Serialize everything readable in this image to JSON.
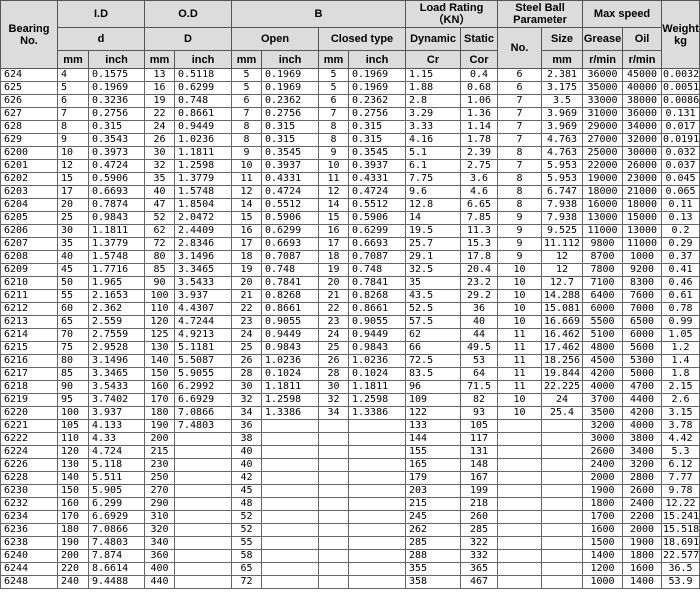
{
  "headers": {
    "bearing_no": "Bearing No.",
    "id": "I.D",
    "od": "O.D",
    "b": "B",
    "load_rating": "Load Rating （KN）",
    "steel_ball": "Steel Ball Parameter",
    "max_speed": "Max speed",
    "weight": "Weight kg",
    "d": "d",
    "D": "D",
    "open": "Open",
    "closed_type": "Closed type",
    "dynamic": "Dynamic",
    "static": "Static",
    "no": "No.",
    "size": "Size",
    "grease": "Grease",
    "oil": "Oil",
    "mm": "mm",
    "inch": "inch",
    "cr": "Cr",
    "cor": "Cor",
    "rmin": "r/min"
  },
  "rows": [
    [
      "624",
      "4",
      "0.1575",
      "13",
      "0.5118",
      "5",
      "0.1969",
      "5",
      "0.1969",
      "1.15",
      "0.4",
      "6",
      "2.381",
      "36000",
      "45000",
      "0.0032"
    ],
    [
      "625",
      "5",
      "0.1969",
      "16",
      "0.6299",
      "5",
      "0.1969",
      "5",
      "0.1969",
      "1.88",
      "0.68",
      "6",
      "3.175",
      "35000",
      "40000",
      "0.0051"
    ],
    [
      "626",
      "6",
      "0.3236",
      "19",
      "0.748",
      "6",
      "0.2362",
      "6",
      "0.2362",
      "2.8",
      "1.06",
      "7",
      "3.5",
      "33000",
      "38000",
      "0.0086"
    ],
    [
      "627",
      "7",
      "0.2756",
      "22",
      "0.8661",
      "7",
      "0.2756",
      "7",
      "0.2756",
      "3.29",
      "1.36",
      "7",
      "3.969",
      "31000",
      "36000",
      "0.131"
    ],
    [
      "628",
      "8",
      "0.315",
      "24",
      "0.9449",
      "8",
      "0.315",
      "8",
      "0.315",
      "3.33",
      "1.14",
      "7",
      "3.969",
      "29000",
      "34000",
      "0.017"
    ],
    [
      "629",
      "9",
      "0.3543",
      "26",
      "1.0236",
      "8",
      "0.315",
      "8",
      "0.315",
      "4.16",
      "1.78",
      "7",
      "4.763",
      "27000",
      "32000",
      "0.0191"
    ],
    [
      "6200",
      "10",
      "0.3973",
      "30",
      "1.1811",
      "9",
      "0.3545",
      "9",
      "0.3545",
      "5.1",
      "2.39",
      "8",
      "4.763",
      "25000",
      "30000",
      "0.032"
    ],
    [
      "6201",
      "12",
      "0.4724",
      "32",
      "1.2598",
      "10",
      "0.3937",
      "10",
      "0.3937",
      "6.1",
      "2.75",
      "7",
      "5.953",
      "22000",
      "26000",
      "0.037"
    ],
    [
      "6202",
      "15",
      "0.5906",
      "35",
      "1.3779",
      "11",
      "0.4331",
      "11",
      "0.4331",
      "7.75",
      "3.6",
      "8",
      "5.953",
      "19000",
      "23000",
      "0.045"
    ],
    [
      "6203",
      "17",
      "0.6693",
      "40",
      "1.5748",
      "12",
      "0.4724",
      "12",
      "0.4724",
      "9.6",
      "4.6",
      "8",
      "6.747",
      "18000",
      "21000",
      "0.065"
    ],
    [
      "6204",
      "20",
      "0.7874",
      "47",
      "1.8504",
      "14",
      "0.5512",
      "14",
      "0.5512",
      "12.8",
      "6.65",
      "8",
      "7.938",
      "16000",
      "18000",
      "0.11"
    ],
    [
      "6205",
      "25",
      "0.9843",
      "52",
      "2.0472",
      "15",
      "0.5906",
      "15",
      "0.5906",
      "14",
      "7.85",
      "9",
      "7.938",
      "13000",
      "15000",
      "0.13"
    ],
    [
      "6206",
      "30",
      "1.1811",
      "62",
      "2.4409",
      "16",
      "0.6299",
      "16",
      "0.6299",
      "19.5",
      "11.3",
      "9",
      "9.525",
      "11000",
      "13000",
      "0.2"
    ],
    [
      "6207",
      "35",
      "1.3779",
      "72",
      "2.8346",
      "17",
      "0.6693",
      "17",
      "0.6693",
      "25.7",
      "15.3",
      "9",
      "11.112",
      "9800",
      "11000",
      "0.29"
    ],
    [
      "6208",
      "40",
      "1.5748",
      "80",
      "3.1496",
      "18",
      "0.7087",
      "18",
      "0.7087",
      "29.1",
      "17.8",
      "9",
      "12",
      "8700",
      "1000",
      "0.37"
    ],
    [
      "6209",
      "45",
      "1.7716",
      "85",
      "3.3465",
      "19",
      "0.748",
      "19",
      "0.748",
      "32.5",
      "20.4",
      "10",
      "12",
      "7800",
      "9200",
      "0.41"
    ],
    [
      "6210",
      "50",
      "1.965",
      "90",
      "3.5433",
      "20",
      "0.7841",
      "20",
      "0.7841",
      "35",
      "23.2",
      "10",
      "12.7",
      "7100",
      "8300",
      "0.46"
    ],
    [
      "6211",
      "55",
      "2.1653",
      "100",
      "3.937",
      "21",
      "0.8268",
      "21",
      "0.8268",
      "43.5",
      "29.2",
      "10",
      "14.288",
      "6400",
      "7600",
      "0.61"
    ],
    [
      "6212",
      "60",
      "2.362",
      "110",
      "4.4307",
      "22",
      "0.8661",
      "22",
      "0.8661",
      "52.5",
      "36",
      "10",
      "15.081",
      "6000",
      "7000",
      "0.78"
    ],
    [
      "6213",
      "65",
      "2.559",
      "120",
      "4.7244",
      "23",
      "0.9055",
      "23",
      "0.9055",
      "57.5",
      "40",
      "10",
      "16.669",
      "5500",
      "6500",
      "0.99"
    ],
    [
      "6214",
      "70",
      "2.7559",
      "125",
      "4.9213",
      "24",
      "0.9449",
      "24",
      "0.9449",
      "62",
      "44",
      "11",
      "16.462",
      "5100",
      "6000",
      "1.05"
    ],
    [
      "6215",
      "75",
      "2.9528",
      "130",
      "5.1181",
      "25",
      "0.9843",
      "25",
      "0.9843",
      "66",
      "49.5",
      "11",
      "17.462",
      "4800",
      "5600",
      "1.2"
    ],
    [
      "6216",
      "80",
      "3.1496",
      "140",
      "5.5087",
      "26",
      "1.0236",
      "26",
      "1.0236",
      "72.5",
      "53",
      "11",
      "18.256",
      "4500",
      "5300",
      "1.4"
    ],
    [
      "6217",
      "85",
      "3.3465",
      "150",
      "5.9055",
      "28",
      "0.1024",
      "28",
      "0.1024",
      "83.5",
      "64",
      "11",
      "19.844",
      "4200",
      "5000",
      "1.8"
    ],
    [
      "6218",
      "90",
      "3.5433",
      "160",
      "6.2992",
      "30",
      "1.1811",
      "30",
      "1.1811",
      "96",
      "71.5",
      "11",
      "22.225",
      "4000",
      "4700",
      "2.15"
    ],
    [
      "6219",
      "95",
      "3.7402",
      "170",
      "6.6929",
      "32",
      "1.2598",
      "32",
      "1.2598",
      "109",
      "82",
      "10",
      "24",
      "3700",
      "4400",
      "2.6"
    ],
    [
      "6220",
      "100",
      "3.937",
      "180",
      "7.0866",
      "34",
      "1.3386",
      "34",
      "1.3386",
      "122",
      "93",
      "10",
      "25.4",
      "3500",
      "4200",
      "3.15"
    ],
    [
      "6221",
      "105",
      "4.133",
      "190",
      "7.4803",
      "36",
      "",
      "",
      "",
      "133",
      "105",
      "",
      "",
      "3200",
      "4000",
      "3.78"
    ],
    [
      "6222",
      "110",
      "4.33",
      "200",
      "",
      "38",
      "",
      "",
      "",
      "144",
      "117",
      "",
      "",
      "3000",
      "3800",
      "4.42"
    ],
    [
      "6224",
      "120",
      "4.724",
      "215",
      "",
      "40",
      "",
      "",
      "",
      "155",
      "131",
      "",
      "",
      "2600",
      "3400",
      "5.3"
    ],
    [
      "6226",
      "130",
      "5.118",
      "230",
      "",
      "40",
      "",
      "",
      "",
      "165",
      "148",
      "",
      "",
      "2400",
      "3200",
      "6.12"
    ],
    [
      "6228",
      "140",
      "5.511",
      "250",
      "",
      "42",
      "",
      "",
      "",
      "179",
      "167",
      "",
      "",
      "2000",
      "2800",
      "7.77"
    ],
    [
      "6230",
      "150",
      "5.905",
      "270",
      "",
      "45",
      "",
      "",
      "",
      "203",
      "199",
      "",
      "",
      "1900",
      "2600",
      "9.78"
    ],
    [
      "6232",
      "160",
      "6.299",
      "290",
      "",
      "48",
      "",
      "",
      "",
      "215",
      "218",
      "",
      "",
      "1800",
      "2400",
      "12.22"
    ],
    [
      "6234",
      "170",
      "6.6929",
      "310",
      "",
      "52",
      "",
      "",
      "",
      "245",
      "260",
      "",
      "",
      "1700",
      "2200",
      "15.241"
    ],
    [
      "6236",
      "180",
      "7.0866",
      "320",
      "",
      "52",
      "",
      "",
      "",
      "262",
      "285",
      "",
      "",
      "1600",
      "2000",
      "15.518"
    ],
    [
      "6238",
      "190",
      "7.4803",
      "340",
      "",
      "55",
      "",
      "",
      "",
      "285",
      "322",
      "",
      "",
      "1500",
      "1900",
      "18.691"
    ],
    [
      "6240",
      "200",
      "7.874",
      "360",
      "",
      "58",
      "",
      "",
      "",
      "288",
      "332",
      "",
      "",
      "1400",
      "1800",
      "22.577"
    ],
    [
      "6244",
      "220",
      "8.6614",
      "400",
      "",
      "65",
      "",
      "",
      "",
      "355",
      "365",
      "",
      "",
      "1200",
      "1600",
      "36.5"
    ],
    [
      "6248",
      "240",
      "9.4488",
      "440",
      "",
      "72",
      "",
      "",
      "",
      "358",
      "467",
      "",
      "",
      "1000",
      "1400",
      "53.9"
    ]
  ]
}
